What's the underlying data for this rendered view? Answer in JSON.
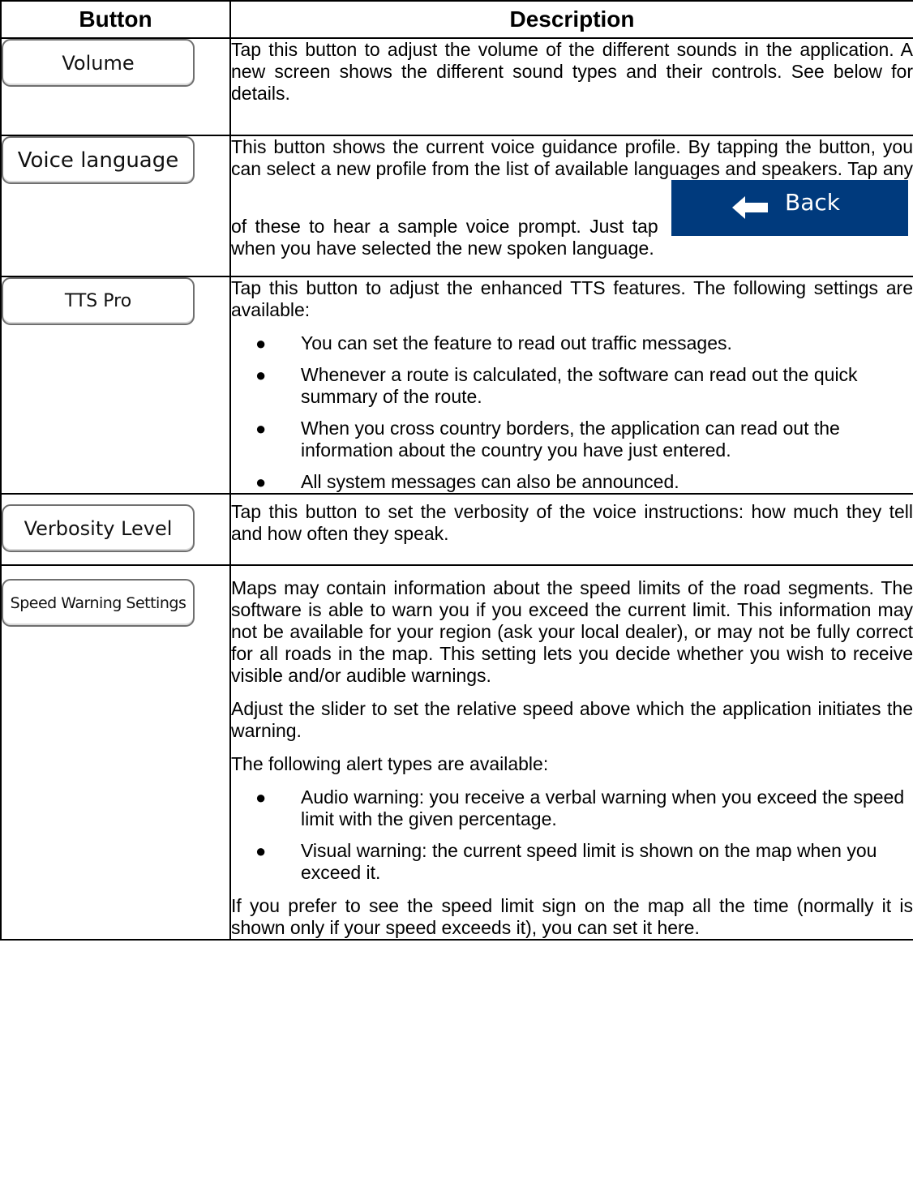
{
  "table": {
    "headers": {
      "button": "Button",
      "description": "Description"
    }
  },
  "rows": [
    {
      "button_label": "Volume",
      "description": "Tap this button to adjust the volume of the different sounds in the application. A new screen shows the different sound types and their controls. See below for details."
    },
    {
      "button_label": "Voice language",
      "description_before": "This button shows the current voice guidance profile. By tapping the button, you can select a new profile from the list of available languages and speakers. Tap any of these to hear a sample voice prompt. Just tap",
      "inline_button": {
        "label": "Back",
        "icon": "back-arrow-icon",
        "color": "#003a7d"
      },
      "description_after": "when you have selected the new spoken language."
    },
    {
      "button_label": "TTS Pro",
      "description": "Tap this button to adjust the enhanced TTS features. The following settings are available:",
      "bullets": [
        "You can set the feature to read out traffic messages.",
        "Whenever a route is calculated, the software can read out the quick summary of the route.",
        "When you cross country borders, the application can read out the information about the country you have just entered.",
        "All system messages can also be announced."
      ]
    },
    {
      "button_label": "Verbosity Level",
      "description": "Tap this button to set the verbosity of the voice instructions: how much they tell and how often they speak."
    },
    {
      "button_label": "Speed Warning Settings",
      "paragraphs": [
        "Maps may contain information about the speed limits of the road segments. The software is able to warn you if you exceed the current limit. This information may not be available for your region (ask your local dealer), or may not be fully correct for all roads in the map. This setting lets you decide whether you wish to receive visible and/or audible warnings.",
        "Adjust the slider to set the relative speed above which the application initiates the warning.",
        "The following alert types are available:"
      ],
      "bullets": [
        "Audio warning: you receive a verbal warning when you exceed the speed limit with the given percentage.",
        "Visual warning: the current speed limit is shown on the map when you exceed it."
      ],
      "closing": "If you prefer to see the speed limit sign on the map all the time (normally it is shown only if your speed exceeds it), you can set it here."
    }
  ]
}
